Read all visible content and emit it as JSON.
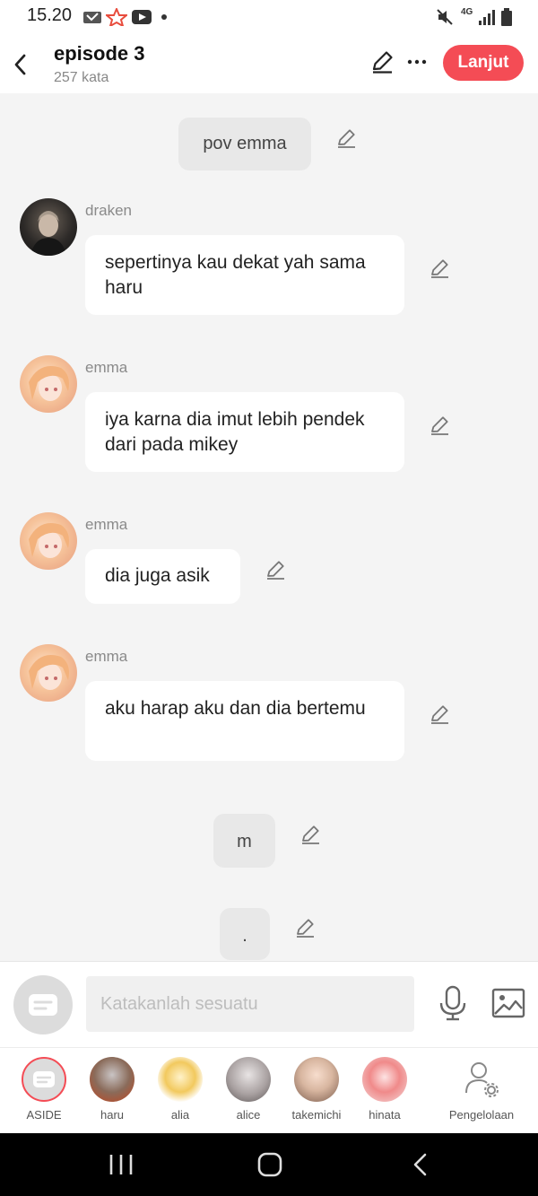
{
  "status_bar": {
    "time": "15.20",
    "network": "4G"
  },
  "header": {
    "title": "episode 3",
    "subtitle": "257 kata",
    "next_label": "Lanjut"
  },
  "chat": {
    "narration_1": "pov emma",
    "msg_1": {
      "sender": "draken",
      "text": "sepertinya kau dekat yah sama haru"
    },
    "msg_2": {
      "sender": "emma",
      "text": "iya karna dia imut lebih pendek dari pada mikey"
    },
    "msg_3": {
      "sender": "emma",
      "text": "dia juga asik"
    },
    "msg_4": {
      "sender": "emma",
      "text": "aku harap aku dan dia bertemu"
    },
    "narration_2": "m",
    "narration_3": "."
  },
  "input": {
    "placeholder": "Katakanlah sesuatu"
  },
  "characters": [
    {
      "label": "ASIDE"
    },
    {
      "label": "haru"
    },
    {
      "label": "alia"
    },
    {
      "label": "alice"
    },
    {
      "label": "takemichi"
    },
    {
      "label": "hinata"
    },
    {
      "label": "Pengelolaan"
    }
  ],
  "colors": {
    "accent": "#f44c55",
    "background": "#f4f4f4",
    "bubble": "#ffffff",
    "narration": "#e8e8e8"
  },
  "icons": [
    "back-icon",
    "pencil-icon",
    "more-icon",
    "chat-icon",
    "mic-icon",
    "image-icon",
    "manage-icon",
    "recents-icon",
    "home-icon",
    "nav-back-icon"
  ]
}
